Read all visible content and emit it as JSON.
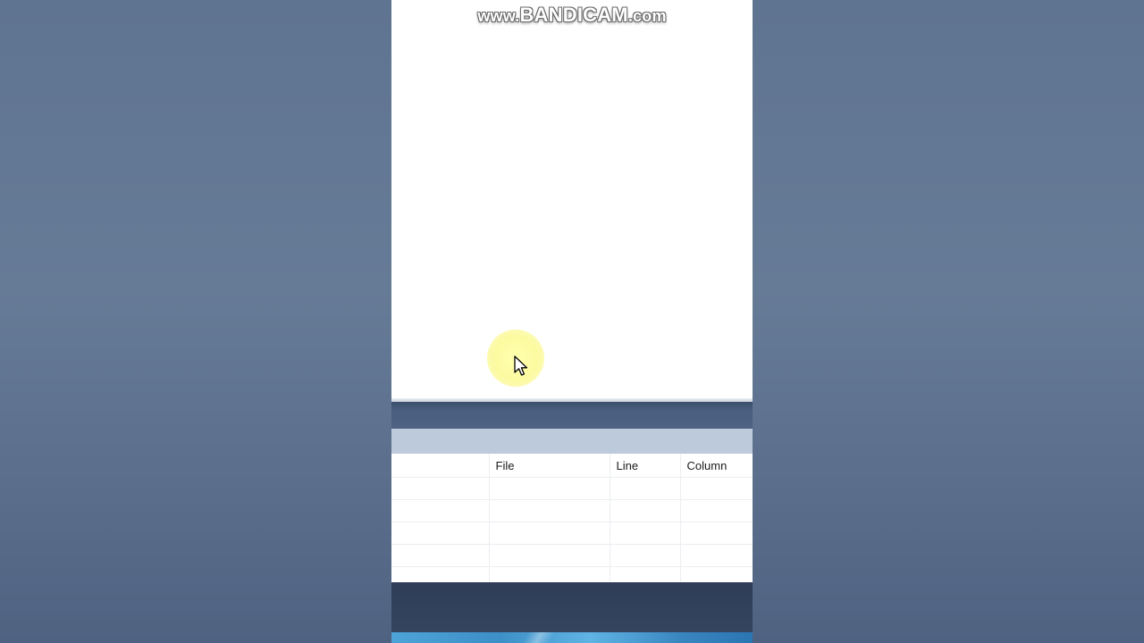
{
  "watermark": {
    "prefix": "www.",
    "brand": "BANDICAM",
    "suffix": ".com"
  },
  "error_list": {
    "columns": [
      {
        "key": "blank",
        "label": ""
      },
      {
        "key": "file",
        "label": "File"
      },
      {
        "key": "line",
        "label": "Line"
      },
      {
        "key": "column",
        "label": "Column"
      }
    ],
    "rows": [
      [
        "",
        "",
        "",
        ""
      ],
      [
        "",
        "",
        "",
        ""
      ],
      [
        "",
        "",
        "",
        ""
      ],
      [
        "",
        "",
        "",
        ""
      ],
      [
        "",
        "",
        "",
        ""
      ]
    ]
  },
  "colors": {
    "background": "#5f7491",
    "panel_header": "#bccadb",
    "dark_bar": "#2f3d56",
    "cursor_highlight": "#fcfa96"
  },
  "icons": {
    "pointer": "arrow-cursor-icon"
  }
}
